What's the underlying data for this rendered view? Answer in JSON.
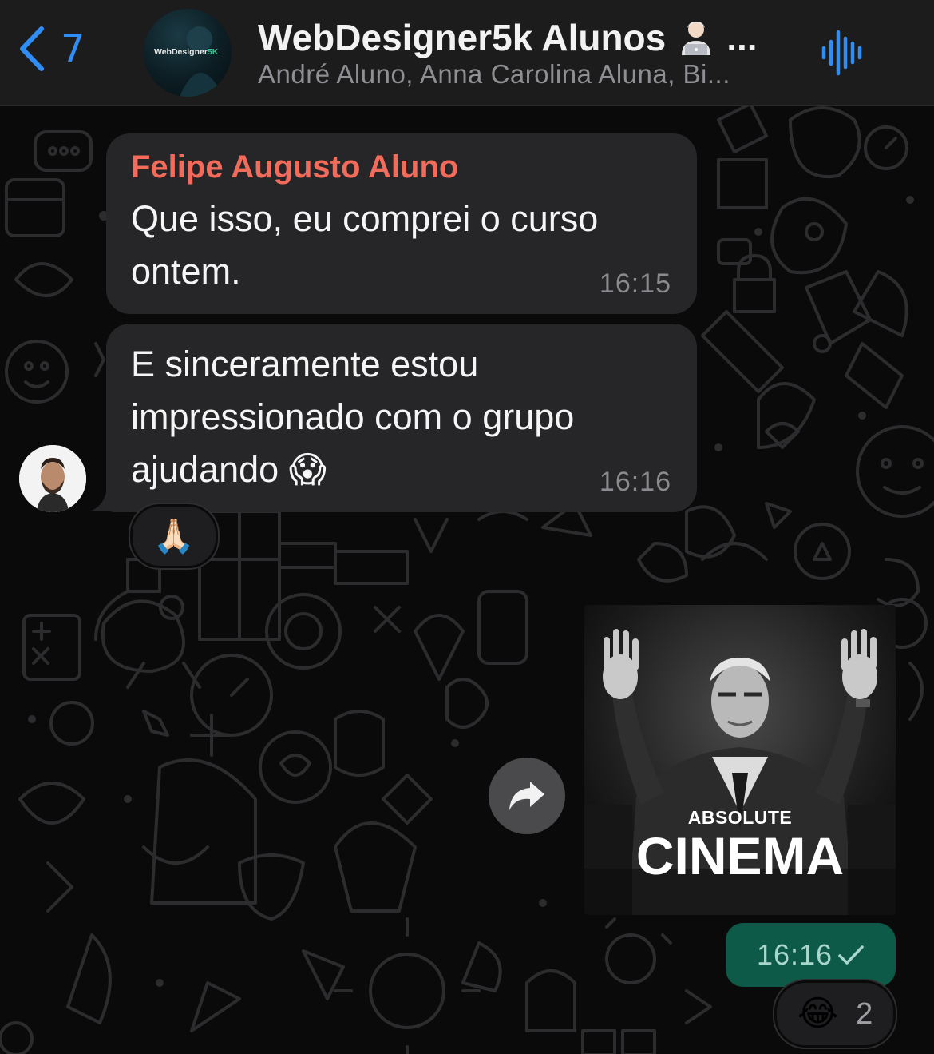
{
  "header": {
    "back_count": "7",
    "group_avatar_logo_a": "WebDesigner",
    "group_avatar_logo_b": "5K",
    "title": "WebDesigner5k Alunos",
    "title_suffix": "...",
    "subtitle": "André Aluno, Anna Carolina Aluna, Bi..."
  },
  "messages": [
    {
      "sender": "Felipe Augusto Aluno",
      "text": "Que isso, eu comprei o curso ontem.",
      "time": "16:15"
    },
    {
      "text": "E sinceramente estou impressionado com o grupo ajudando",
      "emoji": "😱",
      "time": "16:16",
      "reaction": "🙏🏻"
    }
  ],
  "outgoing": {
    "media_caption_small": "ABSOLUTE",
    "media_caption_big": "CINEMA",
    "time": "16:16",
    "reaction_emoji": "😂",
    "reaction_count": "2"
  },
  "colors": {
    "accent": "#2f8ef5",
    "sender": "#f26b5b",
    "outgoing_bubble": "#0e5a48",
    "incoming_bubble": "#262628"
  },
  "icons": [
    "back-chevron-icon",
    "voice-wave-icon",
    "forward-icon",
    "check-icon"
  ]
}
